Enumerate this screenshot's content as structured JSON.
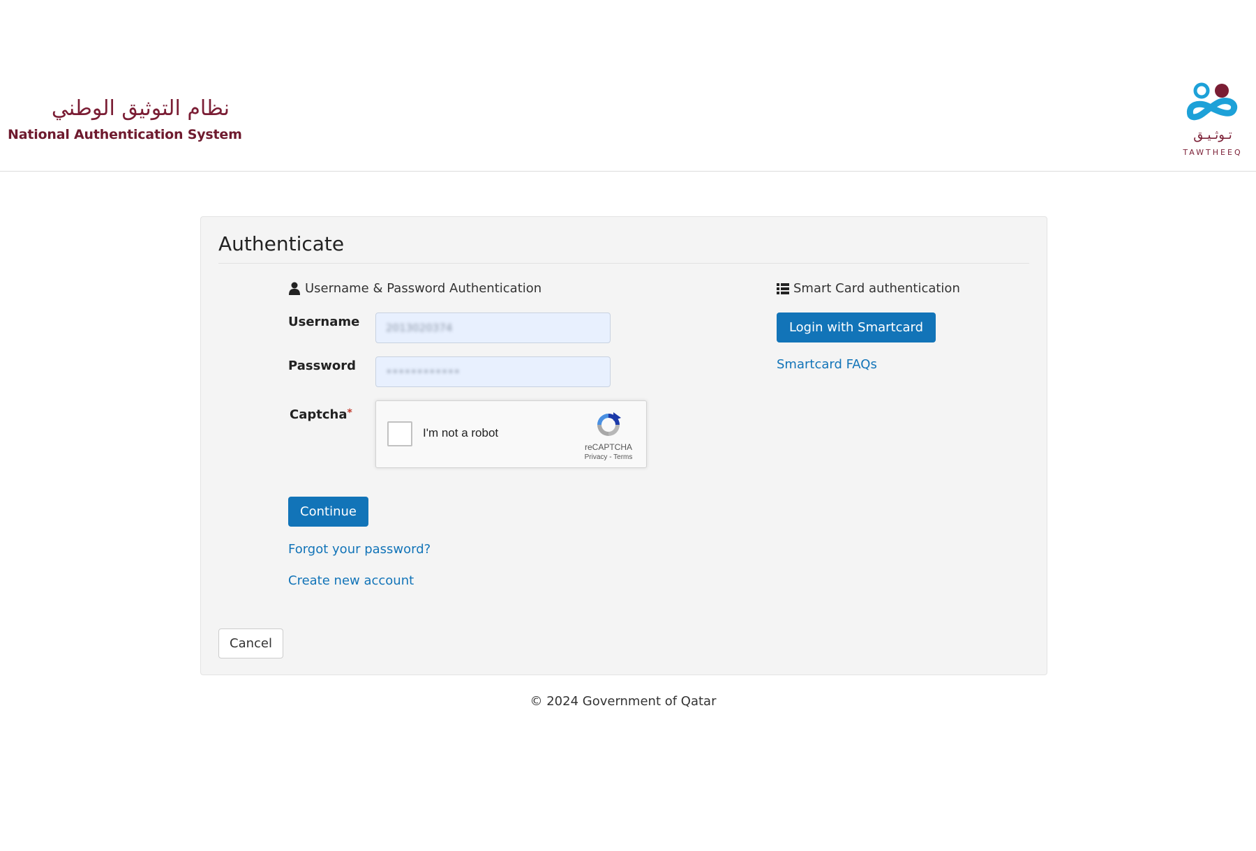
{
  "header": {
    "brand_ar": "نظام التوثيق الوطني",
    "brand_en": "National Authentication System",
    "logo_ar": "تـوثـيـق",
    "logo_en": "TAWTHEEQ"
  },
  "panel": {
    "title": "Authenticate",
    "user_section": {
      "heading": "Username & Password Authentication",
      "icon": "user-icon",
      "username_label": "Username",
      "username_value": "2013020374",
      "password_label": "Password",
      "password_value": "••••••••••••",
      "captcha_label": "Captcha",
      "captcha_required": "*",
      "recaptcha": {
        "checkbox_text": "I'm not a robot",
        "brand": "reCAPTCHA",
        "links": "Privacy - Terms"
      },
      "continue_label": "Continue",
      "forgot_label": "Forgot your password?",
      "create_label": "Create new account"
    },
    "smartcard_section": {
      "heading": "Smart Card authentication",
      "icon": "list-icon",
      "login_label": "Login with Smartcard",
      "faq_label": "Smartcard FAQs"
    },
    "cancel_label": "Cancel"
  },
  "footer": {
    "text": "© 2024 Government of Qatar"
  },
  "colors": {
    "brand": "#7a1d34",
    "primary": "#1274b8",
    "panel_bg": "#f4f4f4",
    "input_bg": "#e8f0fe"
  }
}
